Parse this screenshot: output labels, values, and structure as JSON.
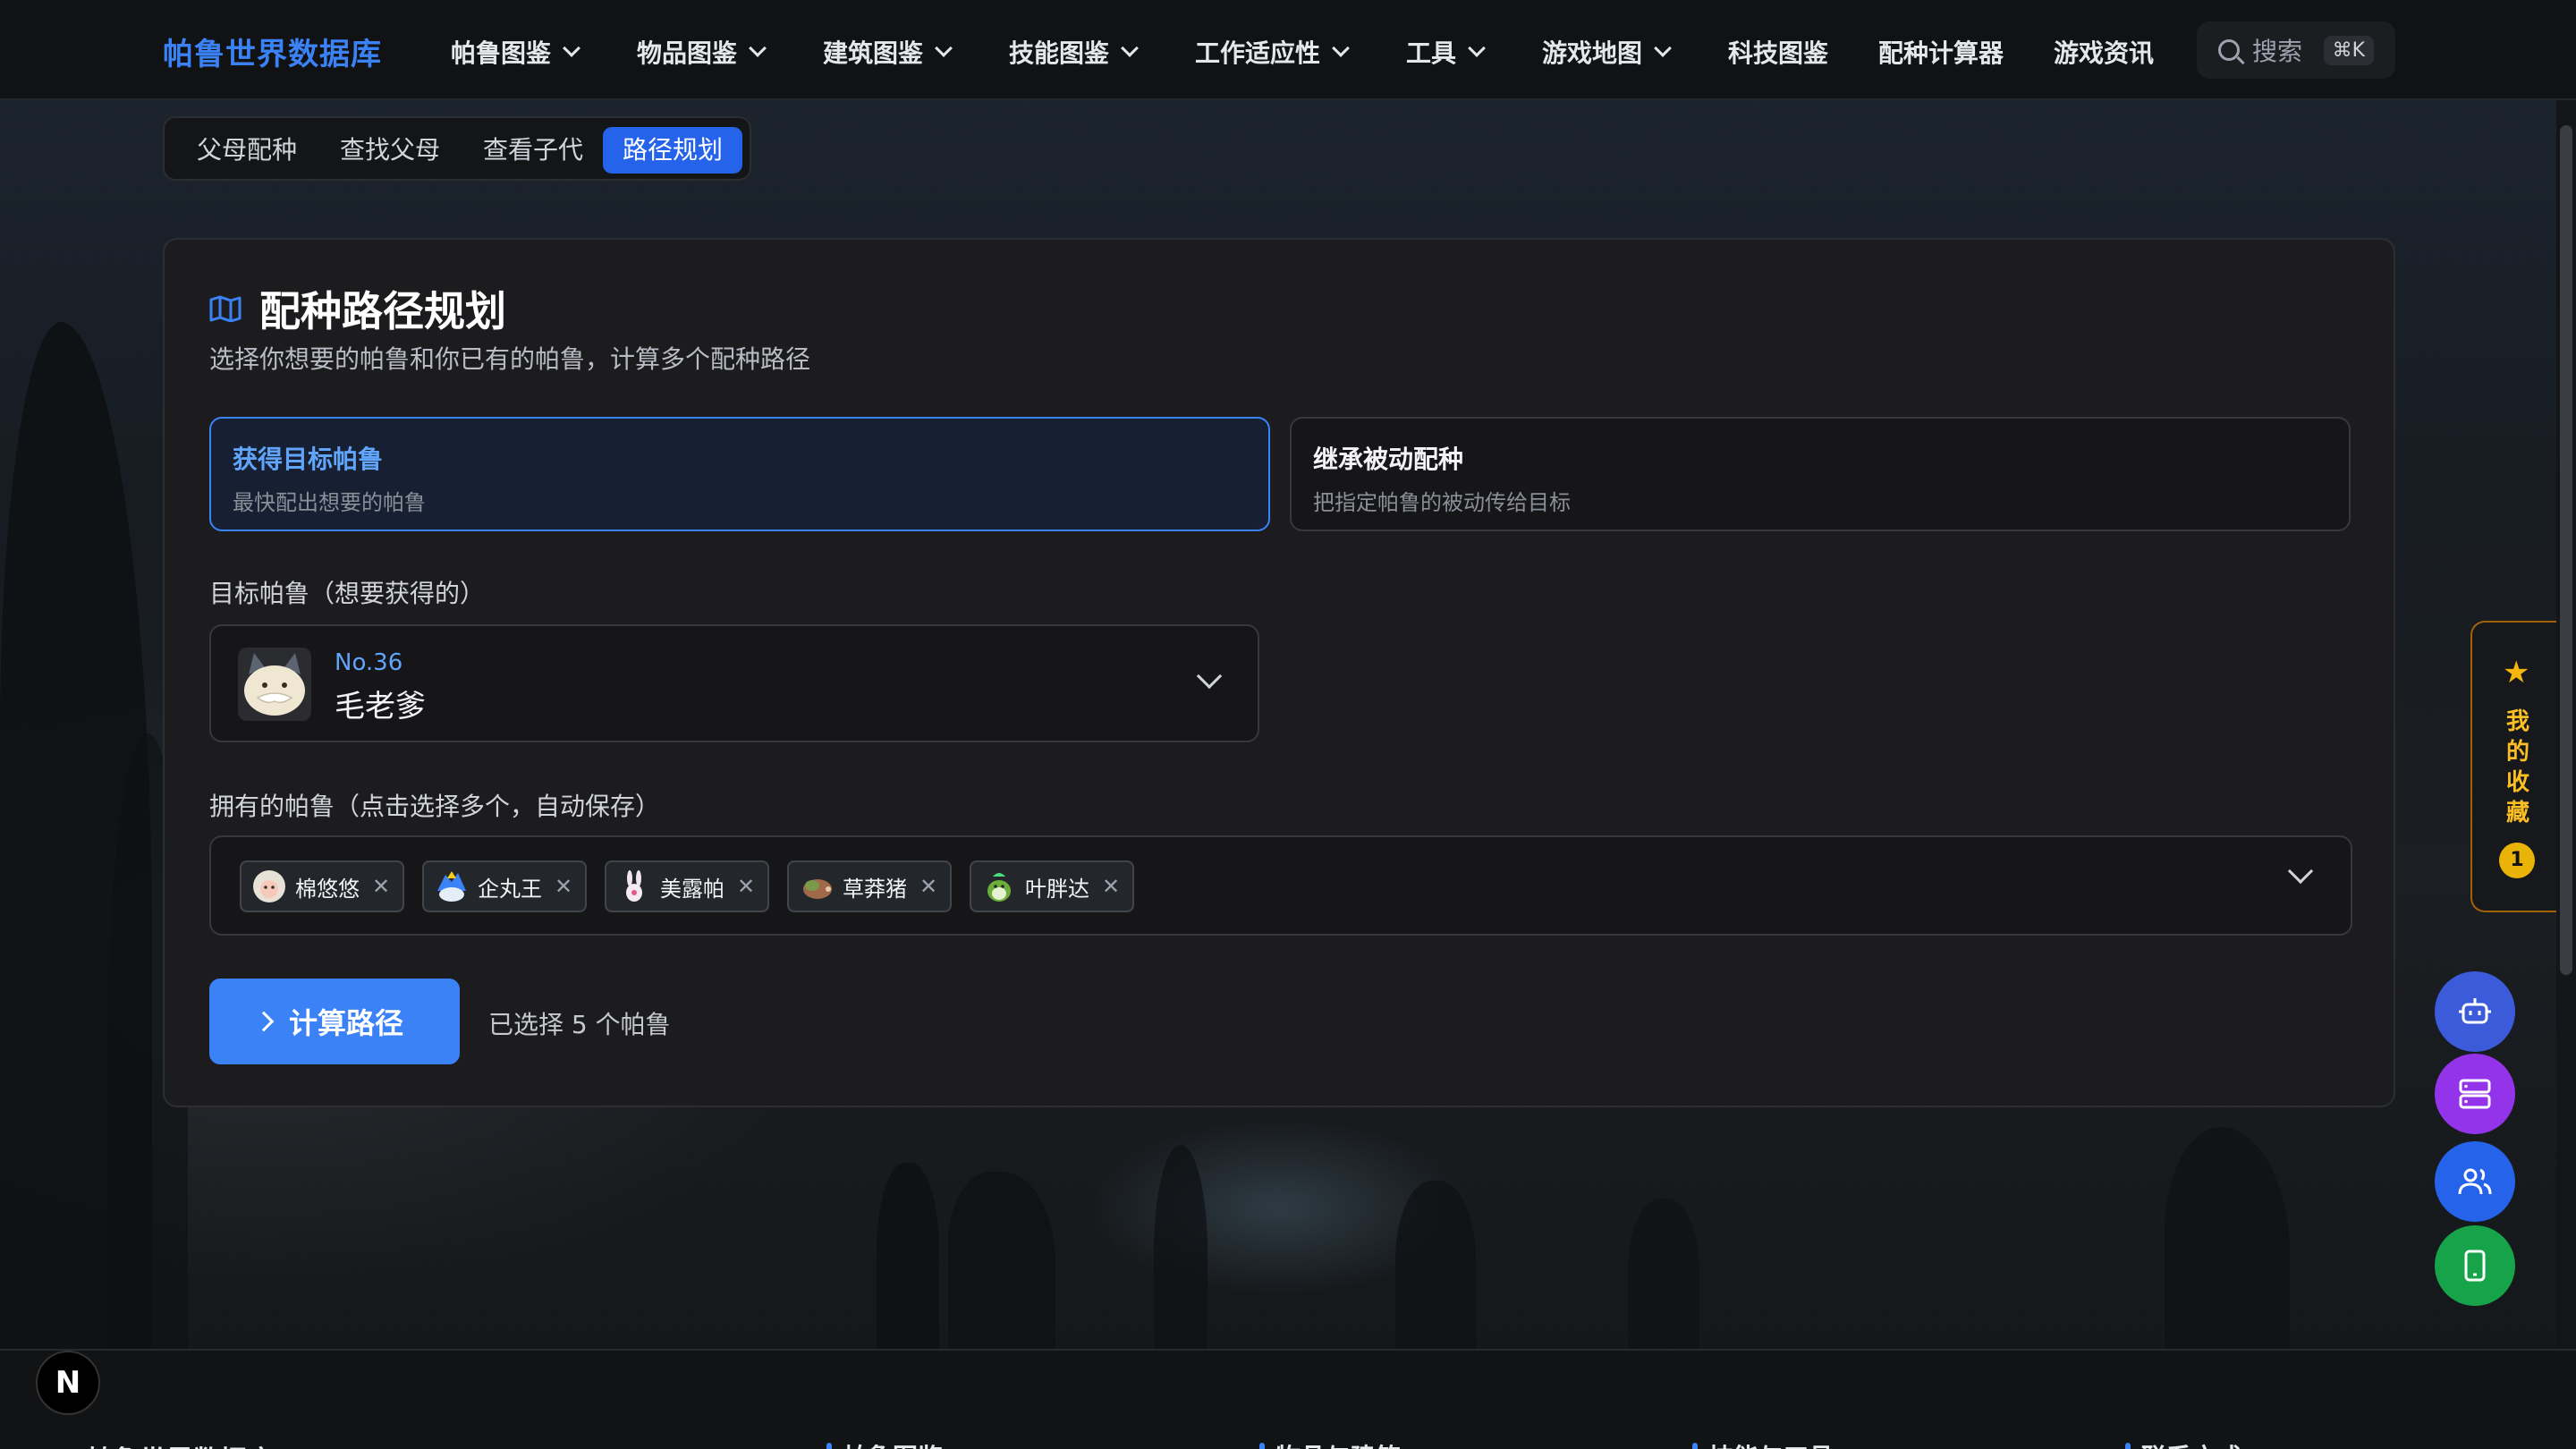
{
  "nav": {
    "brand": "帕鲁世界数据库",
    "items": [
      {
        "label": "帕鲁图鉴",
        "dropdown": true
      },
      {
        "label": "物品图鉴",
        "dropdown": true
      },
      {
        "label": "建筑图鉴",
        "dropdown": true
      },
      {
        "label": "技能图鉴",
        "dropdown": true
      },
      {
        "label": "工作适应性",
        "dropdown": true
      },
      {
        "label": "工具",
        "dropdown": true
      },
      {
        "label": "游戏地图",
        "dropdown": true
      },
      {
        "label": "科技图鉴",
        "dropdown": false
      },
      {
        "label": "配种计算器",
        "dropdown": false
      },
      {
        "label": "游戏资讯",
        "dropdown": false
      }
    ],
    "search_placeholder": "搜索",
    "search_shortcut": "⌘K"
  },
  "tabs": [
    {
      "label": "父母配种",
      "active": false
    },
    {
      "label": "查找父母",
      "active": false
    },
    {
      "label": "查看子代",
      "active": false
    },
    {
      "label": "路径规划",
      "active": true
    }
  ],
  "planner": {
    "title": "配种路径规划",
    "subtitle": "选择你想要的帕鲁和你已有的帕鲁，计算多个配种路径",
    "modes": [
      {
        "title": "获得目标帕鲁",
        "desc": "最快配出想要的帕鲁",
        "active": true
      },
      {
        "title": "继承被动配种",
        "desc": "把指定帕鲁的被动传给目标",
        "active": false
      }
    ],
    "target_label": "目标帕鲁（想要获得的）",
    "target": {
      "number": "No.36",
      "name": "毛老爹"
    },
    "owned_label": "拥有的帕鲁（点击选择多个，自动保存）",
    "owned": [
      "棉悠悠",
      "企丸王",
      "美露帕",
      "草莽猪",
      "叶胖达"
    ],
    "calc_button": "计算路径",
    "selected_count": "已选择 5 个帕鲁"
  },
  "favorites": {
    "label": "我的收藏",
    "count": "1"
  },
  "footer": {
    "brand": "帕鲁世界数据库",
    "columns": [
      "帕鲁图鉴",
      "物品与建筑",
      "技能与工具",
      "联系方式"
    ]
  },
  "colors": {
    "accent": "#3b82f6",
    "fab_robot": "#3b5bdb",
    "fab_server": "#9333ea",
    "fab_users": "#2563eb",
    "fab_mobile": "#16a34a",
    "favorite": "#eab308"
  }
}
